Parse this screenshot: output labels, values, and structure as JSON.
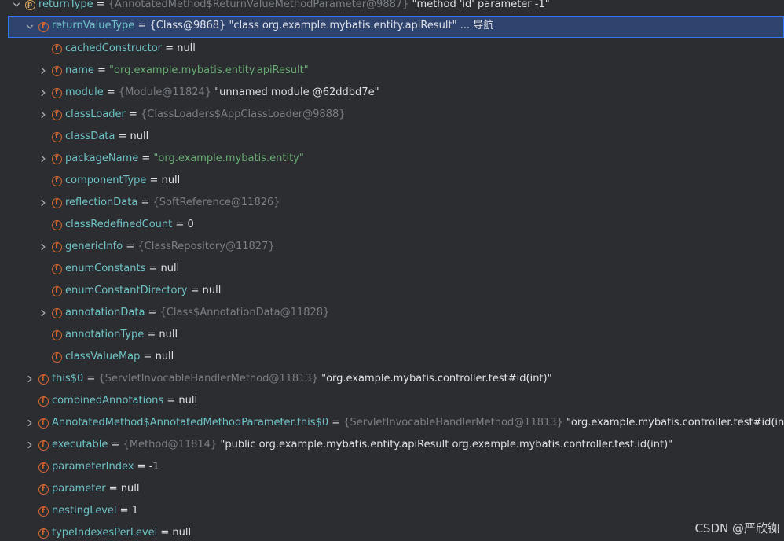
{
  "colors": {
    "background": "#2b2d30",
    "selection": "#2e436e",
    "selection_border": "#3574f0",
    "field_name": "#6ec3c6",
    "type_ref": "#7a7e85",
    "string_literal": "#6aab73",
    "field_icon": "#d9662f",
    "param_icon": "#d8a65a",
    "text": "#dfe1e5"
  },
  "rows": [
    {
      "name": "returnType",
      "type": "{AnnotatedMethod$ReturnValueMethodParameter@9887}",
      "value": "\"method 'id' parameter -1\"",
      "value_kind": "plain",
      "chevron": "down",
      "icon": "param-icon"
    },
    {
      "name": "returnValueType",
      "type": "",
      "value": "{Class@9868} \"class org.example.mybatis.entity.apiResult\"",
      "value_kind": "plain",
      "nav": "... 导航",
      "chevron": "down",
      "icon": "field-icon"
    },
    {
      "name": "cachedConstructor",
      "type": "",
      "value": "null",
      "value_kind": "plain",
      "chevron": "",
      "icon": "field-icon"
    },
    {
      "name": "name",
      "type": "",
      "value": "\"org.example.mybatis.entity.apiResult\"",
      "value_kind": "string",
      "chevron": "right",
      "icon": "field-icon"
    },
    {
      "name": "module",
      "type": "{Module@11824}",
      "value": "\"unnamed module @62ddbd7e\"",
      "value_kind": "plain",
      "chevron": "right",
      "icon": "field-icon"
    },
    {
      "name": "classLoader",
      "type": "{ClassLoaders$AppClassLoader@9888}",
      "value": "",
      "value_kind": "plain",
      "chevron": "right",
      "icon": "field-icon"
    },
    {
      "name": "classData",
      "type": "",
      "value": "null",
      "value_kind": "plain",
      "chevron": "",
      "icon": "field-icon"
    },
    {
      "name": "packageName",
      "type": "",
      "value": "\"org.example.mybatis.entity\"",
      "value_kind": "string",
      "chevron": "right",
      "icon": "field-icon"
    },
    {
      "name": "componentType",
      "type": "",
      "value": "null",
      "value_kind": "plain",
      "chevron": "",
      "icon": "field-icon"
    },
    {
      "name": "reflectionData",
      "type": "{SoftReference@11826}",
      "value": "",
      "value_kind": "plain",
      "chevron": "right",
      "icon": "field-icon"
    },
    {
      "name": "classRedefinedCount",
      "type": "",
      "value": "0",
      "value_kind": "plain",
      "chevron": "",
      "icon": "field-icon"
    },
    {
      "name": "genericInfo",
      "type": "{ClassRepository@11827}",
      "value": "",
      "value_kind": "plain",
      "chevron": "right",
      "icon": "field-icon"
    },
    {
      "name": "enumConstants",
      "type": "",
      "value": "null",
      "value_kind": "plain",
      "chevron": "",
      "icon": "field-icon"
    },
    {
      "name": "enumConstantDirectory",
      "type": "",
      "value": "null",
      "value_kind": "plain",
      "chevron": "",
      "icon": "field-icon"
    },
    {
      "name": "annotationData",
      "type": "{Class$AnnotationData@11828}",
      "value": "",
      "value_kind": "plain",
      "chevron": "right",
      "icon": "field-icon"
    },
    {
      "name": "annotationType",
      "type": "",
      "value": "null",
      "value_kind": "plain",
      "chevron": "",
      "icon": "field-icon"
    },
    {
      "name": "classValueMap",
      "type": "",
      "value": "null",
      "value_kind": "plain",
      "chevron": "",
      "icon": "field-icon"
    },
    {
      "name": "this$0",
      "type": "{ServletInvocableHandlerMethod@11813}",
      "value": "\"org.example.mybatis.controller.test#id(int)\"",
      "value_kind": "plain",
      "chevron": "right",
      "icon": "field-icon"
    },
    {
      "name": "combinedAnnotations",
      "type": "",
      "value": "null",
      "value_kind": "plain",
      "chevron": "",
      "icon": "field-icon"
    },
    {
      "name": "AnnotatedMethod$AnnotatedMethodParameter.this$0",
      "type": "{ServletInvocableHandlerMethod@11813}",
      "value": "\"org.example.mybatis.controller.test#id(int)\"",
      "value_kind": "plain",
      "chevron": "right",
      "icon": "field-icon"
    },
    {
      "name": "executable",
      "type": "{Method@11814}",
      "value": "\"public org.example.mybatis.entity.apiResult org.example.mybatis.controller.test.id(int)\"",
      "value_kind": "plain",
      "chevron": "right",
      "icon": "field-icon"
    },
    {
      "name": "parameterIndex",
      "type": "",
      "value": "-1",
      "value_kind": "plain",
      "chevron": "",
      "icon": "field-icon"
    },
    {
      "name": "parameter",
      "type": "",
      "value": "null",
      "value_kind": "plain",
      "chevron": "",
      "icon": "field-icon"
    },
    {
      "name": "nestingLevel",
      "type": "",
      "value": "1",
      "value_kind": "plain",
      "chevron": "",
      "icon": "field-icon"
    },
    {
      "name": "typeIndexesPerLevel",
      "type": "",
      "value": "null",
      "value_kind": "plain",
      "chevron": "",
      "icon": "field-icon"
    }
  ],
  "equals_sign": "=",
  "watermark": "CSDN @严欣铷"
}
